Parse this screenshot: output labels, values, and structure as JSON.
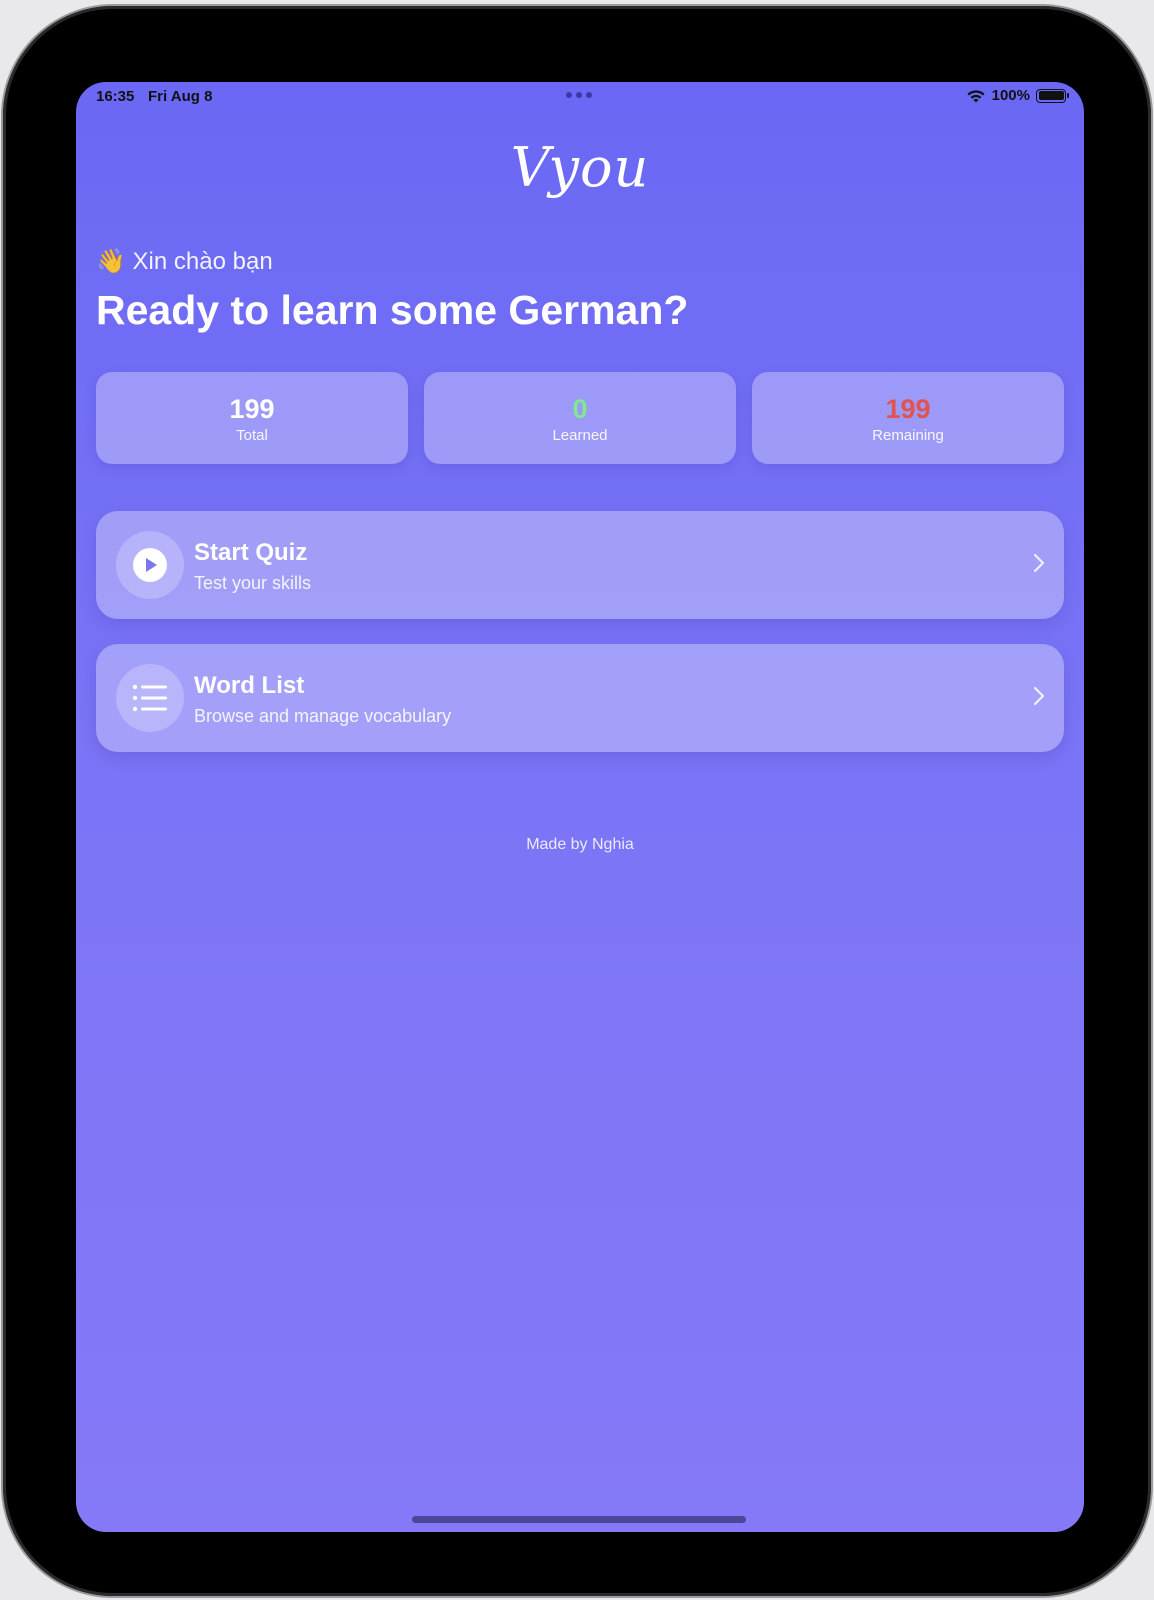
{
  "status_bar": {
    "time": "16:35",
    "date": "Fri Aug 8",
    "battery": "100%"
  },
  "app": {
    "logo": "Vyou",
    "greeting": "👋 Xin chào bạn",
    "headline": "Ready to learn some German?"
  },
  "stats": [
    {
      "value": "199",
      "label": "Total",
      "color": "#ffffff"
    },
    {
      "value": "0",
      "label": "Learned",
      "color": "#7dea8e"
    },
    {
      "value": "199",
      "label": "Remaining",
      "color": "#e0534e"
    }
  ],
  "cards": {
    "quiz": {
      "title": "Start Quiz",
      "subtitle": "Test your skills",
      "icon": "play-icon"
    },
    "wordlist": {
      "title": "Word List",
      "subtitle": "Browse and manage vocabulary",
      "icon": "list-icon"
    }
  },
  "footer": "Made by Nghia"
}
